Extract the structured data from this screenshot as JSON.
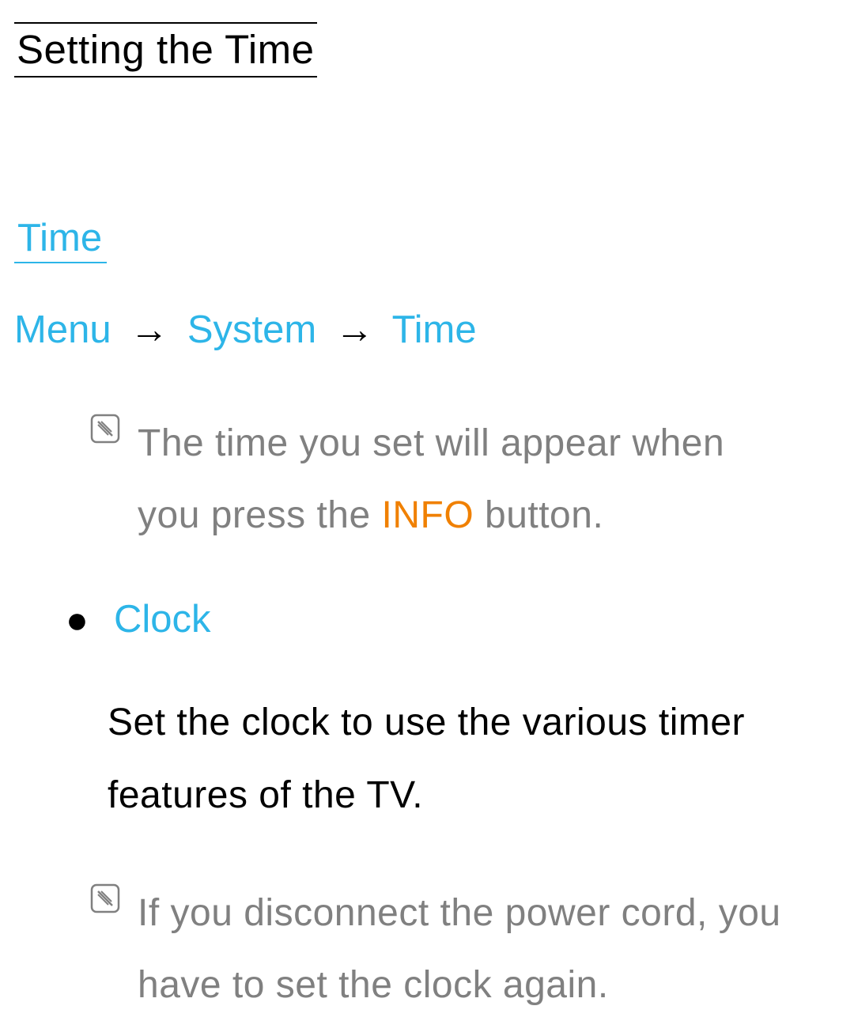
{
  "title": "Setting the Time",
  "section": "Time",
  "breadcrumb": {
    "item1": "Menu",
    "item2": "System",
    "item3": "Time",
    "arrow": "→"
  },
  "note1": {
    "pre": "The time you set will appear when you press the ",
    "highlight": "INFO",
    "post": " button."
  },
  "bullet": {
    "label": "Clock"
  },
  "body": "Set the clock to use the various timer features of the TV.",
  "note2": "If you disconnect the power cord, you have to set the clock again."
}
